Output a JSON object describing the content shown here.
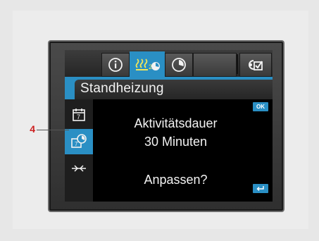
{
  "display": {
    "tabs": [
      {
        "name": "info",
        "icon": "info-icon",
        "active": false
      },
      {
        "name": "heating",
        "icon": "parking-heater-icon",
        "active": true
      },
      {
        "name": "timer",
        "icon": "clock-icon",
        "active": false
      },
      {
        "name": "blank",
        "icon": "",
        "active": false
      },
      {
        "name": "settings",
        "icon": "check-settings-icon",
        "active": false
      }
    ],
    "title": "Standheizung",
    "sidebar": [
      {
        "icon": "calendar-7-icon",
        "active": false
      },
      {
        "icon": "calendar-timer-icon",
        "active": true
      },
      {
        "icon": "ventilation-icon",
        "active": false
      }
    ],
    "message_line1": "Aktivitätsdauer",
    "message_line2": "30 Minuten",
    "prompt": "Anpassen?",
    "ok_label": "OK",
    "back_icon": "return-icon"
  },
  "callout": {
    "number": "4",
    "color": "#cc1f1f"
  },
  "colors": {
    "accent": "#2a8fc4",
    "screen_bg": "#050505",
    "text": "#f2f2f2"
  }
}
